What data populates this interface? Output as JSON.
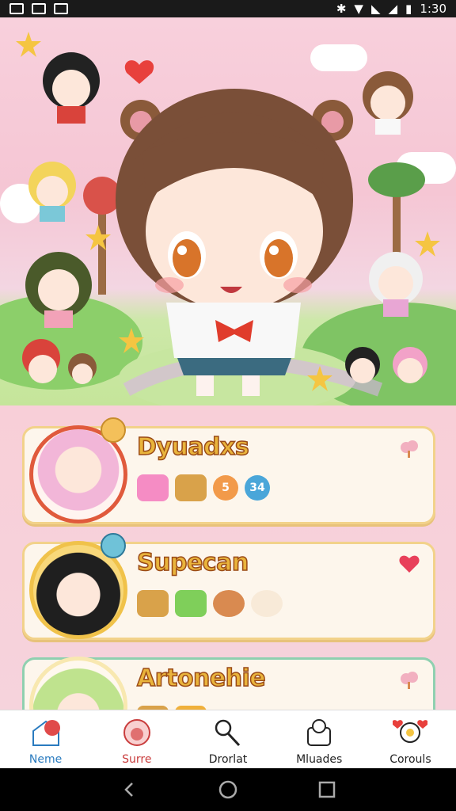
{
  "status_bar": {
    "time": "1:30"
  },
  "cards": [
    {
      "name": "Dyuadxs",
      "pills": [
        "5",
        "34"
      ],
      "colors": {
        "accent": "#e05a3c"
      }
    },
    {
      "name": "Supecan",
      "pills": [],
      "colors": {
        "accent": "#2b2b2b"
      }
    },
    {
      "name": "Artonehie",
      "pills": [],
      "colors": {
        "accent": "#8cc07a"
      }
    }
  ],
  "bottom_nav": [
    {
      "label": "Neme",
      "icon": "home-icon"
    },
    {
      "label": "Surre",
      "icon": "face-icon"
    },
    {
      "label": "Drorlat",
      "icon": "magnifier-icon"
    },
    {
      "label": "Mluades",
      "icon": "storage-icon"
    },
    {
      "label": "Corouls",
      "icon": "flower-icon"
    }
  ],
  "colors": {
    "brand": "#e9b43c",
    "active_nav": "#2a7bbf",
    "surre_nav": "#c93d3d"
  }
}
